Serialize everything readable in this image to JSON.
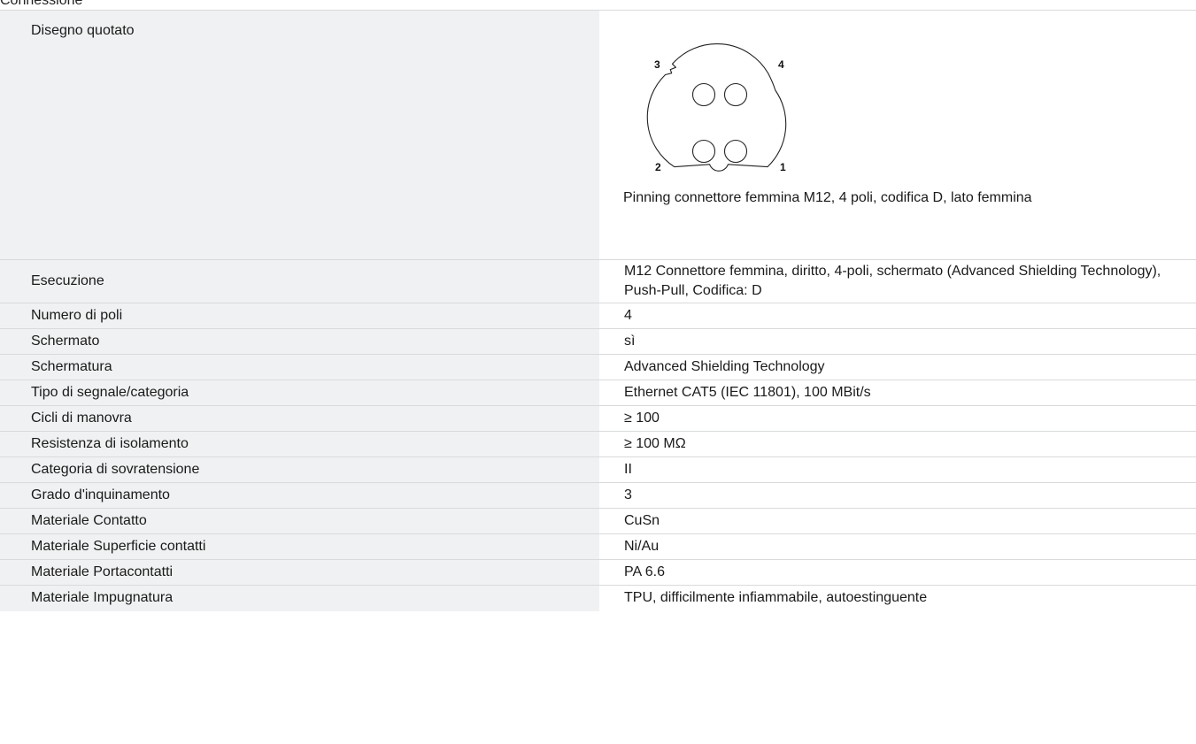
{
  "section": {
    "heading": "Connessione"
  },
  "drawing": {
    "label": "Disegno quotato",
    "pin_labels": [
      "3",
      "4",
      "2",
      "1"
    ],
    "caption": "Pinning connettore femmina M12, 4 poli, codifica D, lato femmina"
  },
  "rows": [
    {
      "label": "Esecuzione",
      "value": "M12 Connettore femmina, diritto, 4-poli, schermato (Advanced Shielding Technology), Push-Pull, Codifica: D"
    },
    {
      "label": "Numero di poli",
      "value": "4"
    },
    {
      "label": "Schermato",
      "value": "sì"
    },
    {
      "label": "Schermatura",
      "value": "Advanced Shielding Technology"
    },
    {
      "label": "Tipo di segnale/categoria",
      "value": "Ethernet CAT5 (IEC 11801), 100 MBit/s"
    },
    {
      "label": "Cicli di manovra",
      "value": "≥ 100"
    },
    {
      "label": "Resistenza di isolamento",
      "value": "≥ 100 MΩ"
    },
    {
      "label": "Categoria di sovratensione",
      "value": "II"
    },
    {
      "label": "Grado d'inquinamento",
      "value": "3"
    },
    {
      "label": "Materiale Contatto",
      "value": "CuSn"
    },
    {
      "label": "Materiale Superficie contatti",
      "value": "Ni/Au"
    },
    {
      "label": "Materiale Portacontatti",
      "value": "PA 6.6"
    },
    {
      "label": "Materiale Impugnatura",
      "value": "TPU, difficilmente infiammabile, autoestinguente"
    }
  ]
}
